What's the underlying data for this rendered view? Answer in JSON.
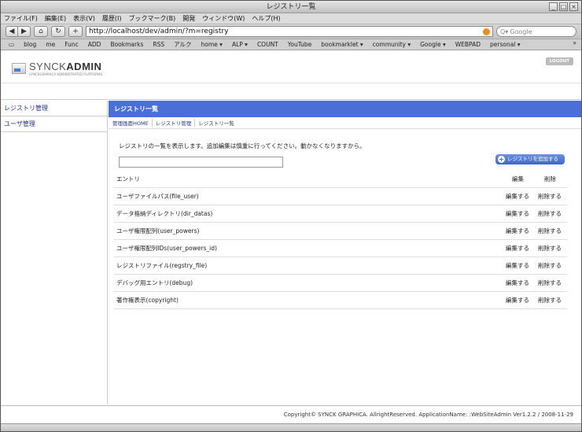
{
  "window": {
    "title": "レジストリ一覧"
  },
  "menu": [
    "ファイル(F)",
    "編集(E)",
    "表示(V)",
    "履歴(I)",
    "ブックマーク(B)",
    "開発",
    "ウィンドウ(W)",
    "ヘルプ(H)"
  ],
  "toolbar": {
    "back_icon": "◀",
    "forward_icon": "▶",
    "home_icon": "⌂",
    "reload_icon": "↻",
    "add_icon": "+",
    "url": "http://localhost/dev/admin/?m=registry",
    "search_placeholder": "Google"
  },
  "bookmarks": [
    "blog",
    "me",
    "Func",
    "ADD",
    "Bookmarks",
    "RSS",
    "アルク",
    "home ▾",
    "ALP ▾",
    "COUNT",
    "YouTube",
    "bookmarklet ▾",
    "community ▾",
    "Google ▾",
    "WEBPAD",
    "personal ▾"
  ],
  "header": {
    "logo_light": "SYNCK",
    "logo_bold": "ADMIN",
    "logo_sub": "SYNCKGRAPHICA ADMINISTRATED PLATFORMS.",
    "logout_label": "LOGOUT"
  },
  "sidebar": {
    "items": [
      {
        "label": "レジストリ管理"
      },
      {
        "label": "ユーザ管理"
      }
    ]
  },
  "main": {
    "section_title": "レジストリ一覧",
    "breadcrumbs": [
      "管理画面HOME",
      "レジストリ管理",
      "レジストリ一覧"
    ],
    "description": "レジストリの一覧を表示します。追加編集は慎重に行ってください。動かなくなりますから。",
    "add_button": "レジストリを追加する",
    "table": {
      "headers": {
        "entry": "エントリ",
        "edit": "編集",
        "delete": "削除"
      },
      "rows": [
        {
          "entry": "ユーザファイルパス(file_user)",
          "edit": "編集する",
          "delete": "削除する"
        },
        {
          "entry": "データ格納ディレクトリ(dir_datas)",
          "edit": "編集する",
          "delete": "削除する"
        },
        {
          "entry": "ユーザ権限配列(user_powers)",
          "edit": "編集する",
          "delete": "削除する"
        },
        {
          "entry": "ユーザ権限配列IDs(user_powers_id)",
          "edit": "編集する",
          "delete": "削除する"
        },
        {
          "entry": "レジストリファイル(regstry_file)",
          "edit": "編集する",
          "delete": "削除する"
        },
        {
          "entry": "デバッグ用エントリ(debug)",
          "edit": "編集する",
          "delete": "削除する"
        },
        {
          "entry": "著作権表示(copyright)",
          "edit": "編集する",
          "delete": "削除する"
        }
      ]
    }
  },
  "footer": {
    "text": "Copyright© SYNCK GRAPHICA. AllrightReserved. ApplicationName: :WebSiteAdmin Ver1.2.2 / 2008-11-29"
  }
}
